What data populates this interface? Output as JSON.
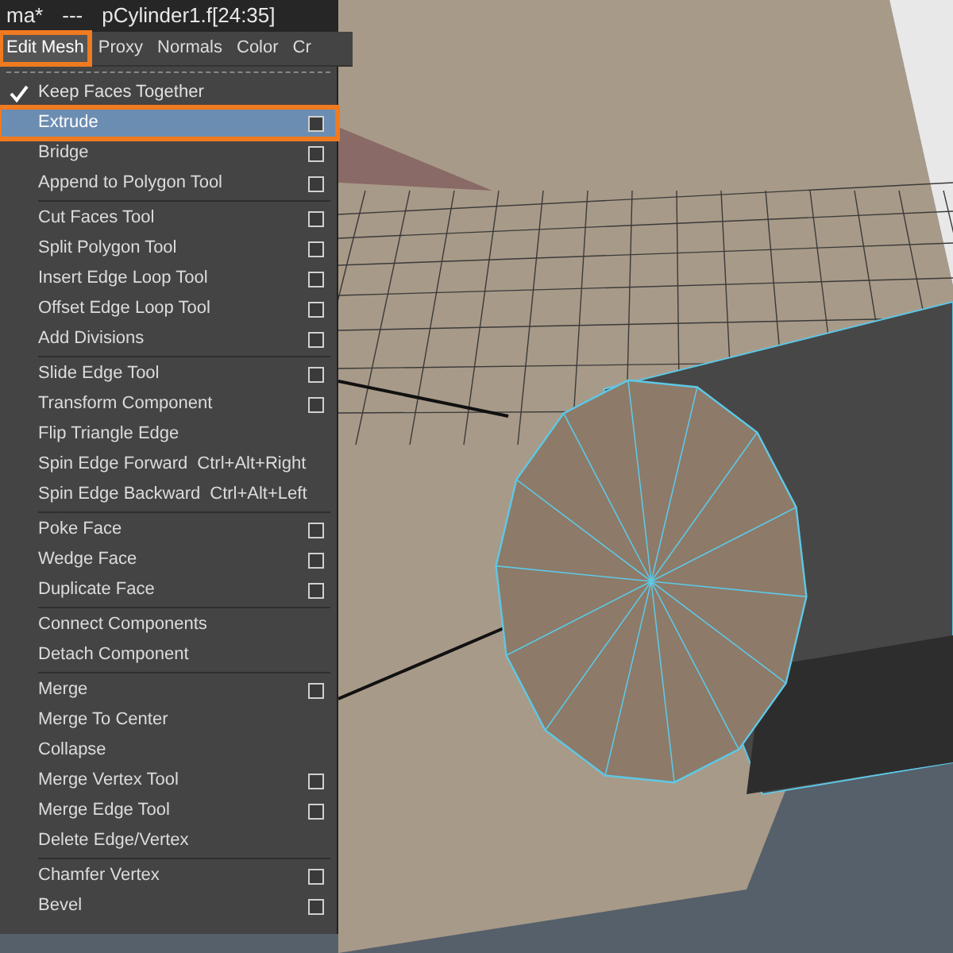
{
  "title_bar": {
    "parts": [
      "ma*",
      "---",
      "pCylinder1.f[24:35]"
    ]
  },
  "menu_bar": [
    {
      "label": "Edit Mesh",
      "selected": true,
      "highlighted": true
    },
    {
      "label": "Proxy",
      "selected": false,
      "highlighted": false
    },
    {
      "label": "Normals",
      "selected": false,
      "highlighted": false
    },
    {
      "label": "Color",
      "selected": false,
      "highlighted": false
    },
    {
      "label": "Cr",
      "selected": false,
      "highlighted": false
    }
  ],
  "menu": {
    "sections": [
      {
        "items": [
          {
            "kind": "check",
            "label": "Keep Faces Together",
            "checked": true
          },
          {
            "kind": "item",
            "label": "Extrude",
            "option_box": true,
            "selected": true,
            "highlighted": true
          },
          {
            "kind": "item",
            "label": "Bridge",
            "option_box": true,
            "selected": false,
            "highlighted": false
          },
          {
            "kind": "item",
            "label": "Append to Polygon Tool",
            "option_box": true,
            "selected": false,
            "highlighted": false
          }
        ]
      },
      {
        "items": [
          {
            "kind": "item",
            "label": "Cut Faces Tool",
            "option_box": true,
            "selected": false,
            "highlighted": false
          },
          {
            "kind": "item",
            "label": "Split Polygon Tool",
            "option_box": true,
            "selected": false,
            "highlighted": false
          },
          {
            "kind": "item",
            "label": "Insert Edge Loop Tool",
            "option_box": true,
            "selected": false,
            "highlighted": false
          },
          {
            "kind": "item",
            "label": "Offset Edge Loop Tool",
            "option_box": true,
            "selected": false,
            "highlighted": false
          },
          {
            "kind": "item",
            "label": "Add Divisions",
            "option_box": true,
            "selected": false,
            "highlighted": false
          }
        ]
      },
      {
        "items": [
          {
            "kind": "item",
            "label": "Slide Edge Tool",
            "option_box": true,
            "selected": false,
            "highlighted": false
          },
          {
            "kind": "item",
            "label": "Transform Component",
            "option_box": true,
            "selected": false,
            "highlighted": false
          },
          {
            "kind": "item",
            "label": "Flip Triangle Edge",
            "option_box": false,
            "selected": false,
            "highlighted": false
          },
          {
            "kind": "item",
            "label": "Spin Edge Forward",
            "shortcut": "Ctrl+Alt+Right",
            "option_box": false,
            "selected": false,
            "highlighted": false
          },
          {
            "kind": "item",
            "label": "Spin Edge Backward",
            "shortcut": "Ctrl+Alt+Left",
            "option_box": false,
            "selected": false,
            "highlighted": false
          }
        ]
      },
      {
        "items": [
          {
            "kind": "item",
            "label": "Poke Face",
            "option_box": true,
            "selected": false,
            "highlighted": false
          },
          {
            "kind": "item",
            "label": "Wedge Face",
            "option_box": true,
            "selected": false,
            "highlighted": false
          },
          {
            "kind": "item",
            "label": "Duplicate Face",
            "option_box": true,
            "selected": false,
            "highlighted": false
          }
        ]
      },
      {
        "items": [
          {
            "kind": "item",
            "label": "Connect Components",
            "option_box": false,
            "selected": false,
            "highlighted": false
          },
          {
            "kind": "item",
            "label": "Detach Component",
            "option_box": false,
            "selected": false,
            "highlighted": false
          }
        ]
      },
      {
        "items": [
          {
            "kind": "item",
            "label": "Merge",
            "option_box": true,
            "selected": false,
            "highlighted": false
          },
          {
            "kind": "item",
            "label": "Merge To Center",
            "option_box": false,
            "selected": false,
            "highlighted": false
          },
          {
            "kind": "item",
            "label": "Collapse",
            "option_box": false,
            "selected": false,
            "highlighted": false
          },
          {
            "kind": "item",
            "label": "Merge Vertex Tool",
            "option_box": true,
            "selected": false,
            "highlighted": false
          },
          {
            "kind": "item",
            "label": "Merge Edge Tool",
            "option_box": true,
            "selected": false,
            "highlighted": false
          },
          {
            "kind": "item",
            "label": "Delete Edge/Vertex",
            "option_box": false,
            "selected": false,
            "highlighted": false
          }
        ]
      },
      {
        "items": [
          {
            "kind": "item",
            "label": "Chamfer Vertex",
            "option_box": true,
            "selected": false,
            "highlighted": false
          },
          {
            "kind": "item",
            "label": "Bevel",
            "option_box": true,
            "selected": false,
            "highlighted": false
          }
        ]
      }
    ]
  }
}
